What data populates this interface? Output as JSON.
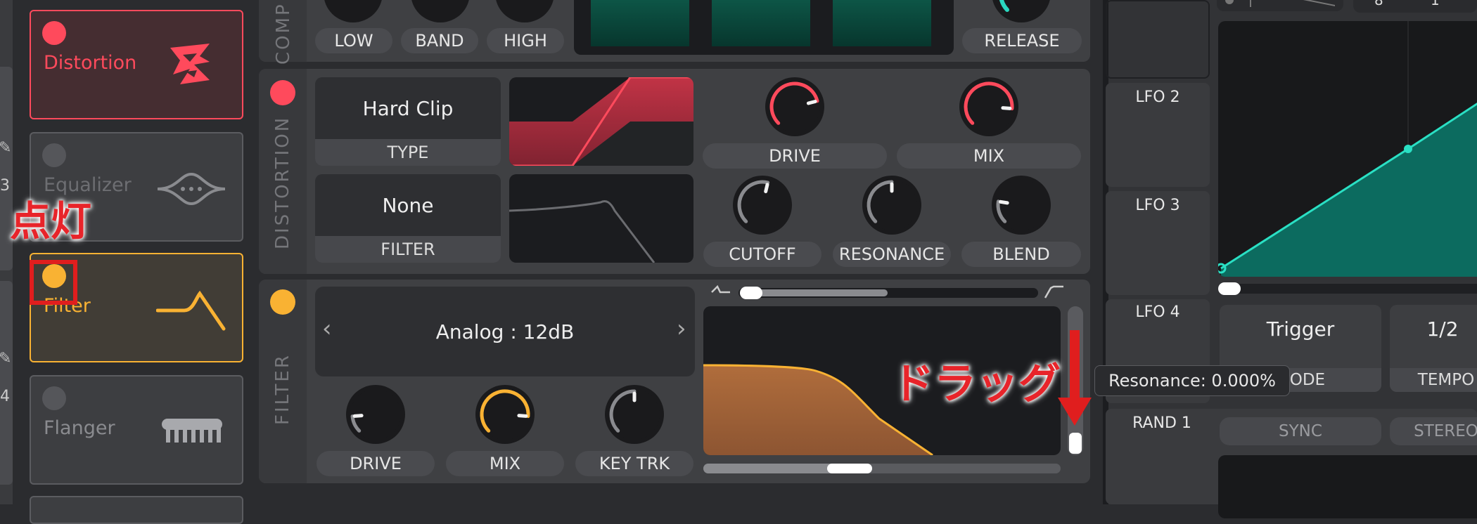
{
  "sidebar": {
    "effects": [
      {
        "name": "Distortion",
        "state": "on",
        "color": "#ff4a5c"
      },
      {
        "name": "Equalizer",
        "state": "off",
        "color": "#6a6b6f"
      },
      {
        "name": "Filter",
        "state": "on",
        "color": "#f9b233"
      },
      {
        "name": "Flanger",
        "state": "off",
        "color": "#6a6b6f"
      }
    ],
    "left_digits": [
      "3",
      "4"
    ],
    "icons": [
      "distortion-icon",
      "equalizer-icon",
      "filter-curve-icon",
      "flanger-comb-icon"
    ]
  },
  "compressor": {
    "title": "COMP",
    "labels": [
      "LOW",
      "BAND",
      "HIGH"
    ],
    "release_label": "RELEASE"
  },
  "distortion": {
    "title": "DISTORTION",
    "type_value": "Hard Clip",
    "type_label": "TYPE",
    "filter_value": "None",
    "filter_label": "FILTER",
    "knobs": [
      {
        "label": "DRIVE",
        "value": 0.78,
        "color": "#ff4a5c"
      },
      {
        "label": "MIX",
        "value": 0.85,
        "color": "#ff4a5c"
      },
      {
        "label": "CUTOFF",
        "value": 0.55,
        "color": "#8a8b8f"
      },
      {
        "label": "RESONANCE",
        "value": 0.5,
        "color": "#8a8b8f"
      },
      {
        "label": "BLEND",
        "value": 0.2,
        "color": "#8a8b8f"
      }
    ]
  },
  "filter": {
    "title": "FILTER",
    "model": "Analog : 12dB",
    "prev": "‹",
    "next": "›",
    "knobs": [
      {
        "label": "DRIVE",
        "value": 0.15,
        "color": "#8a8b8f"
      },
      {
        "label": "MIX",
        "value": 0.85,
        "color": "#f9b233"
      },
      {
        "label": "KEY TRK",
        "value": 0.5,
        "color": "#8a8b8f"
      }
    ]
  },
  "modulation": {
    "lfo_labels": [
      "LFO 2",
      "LFO 3",
      "LFO 4"
    ],
    "rand_label": "RAND 1",
    "trigger": "Trigger",
    "mode_label": "MODE",
    "tempo_value": "1/2",
    "tempo_label": "TEMPO",
    "sync_label": "SYNC",
    "stereo_label": "STEREO",
    "top_numbers": [
      "8",
      "1"
    ]
  },
  "tooltip": "Resonance: 0.000%",
  "annotations": {
    "light_on": "点灯",
    "drag": "ドラッグ"
  }
}
